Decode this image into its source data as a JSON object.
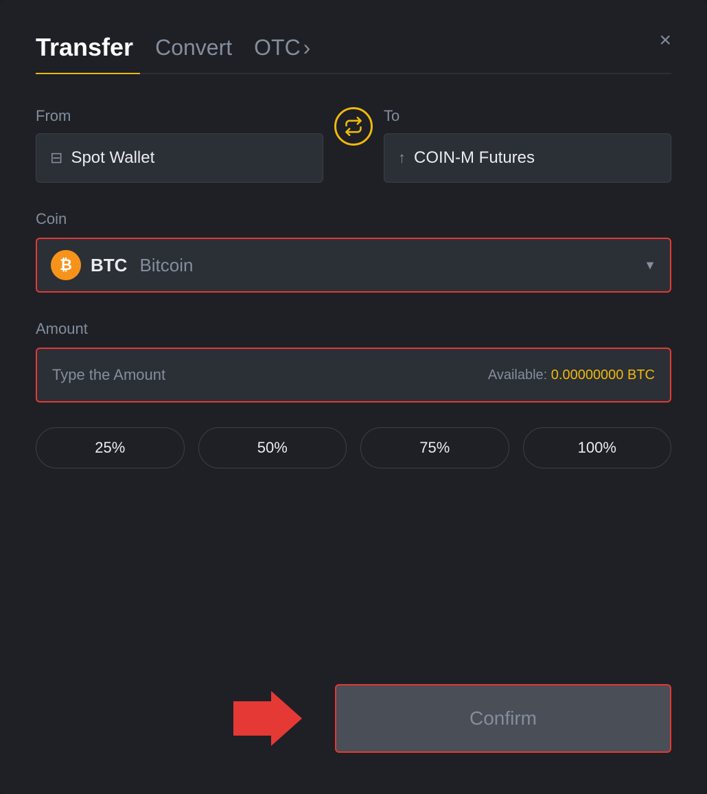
{
  "header": {
    "tab_transfer": "Transfer",
    "tab_convert": "Convert",
    "tab_otc": "OTC",
    "otc_chevron": "›",
    "close_label": "×"
  },
  "from_section": {
    "label": "From",
    "wallet_name": "Spot Wallet"
  },
  "to_section": {
    "label": "To",
    "wallet_name": "COIN-M Futures"
  },
  "coin_section": {
    "label": "Coin",
    "coin_symbol": "BTC",
    "coin_name": "Bitcoin",
    "coin_icon": "₿"
  },
  "amount_section": {
    "label": "Amount",
    "placeholder": "Type the Amount",
    "available_label": "Available:",
    "available_value": "0.00000000 BTC"
  },
  "percentage_buttons": [
    {
      "label": "25%"
    },
    {
      "label": "50%"
    },
    {
      "label": "75%"
    },
    {
      "label": "100%"
    }
  ],
  "confirm_button": {
    "label": "Confirm"
  },
  "colors": {
    "accent": "#f0b90b",
    "red": "#e53935",
    "text_primary": "#eaecef",
    "text_secondary": "#848e9c"
  }
}
